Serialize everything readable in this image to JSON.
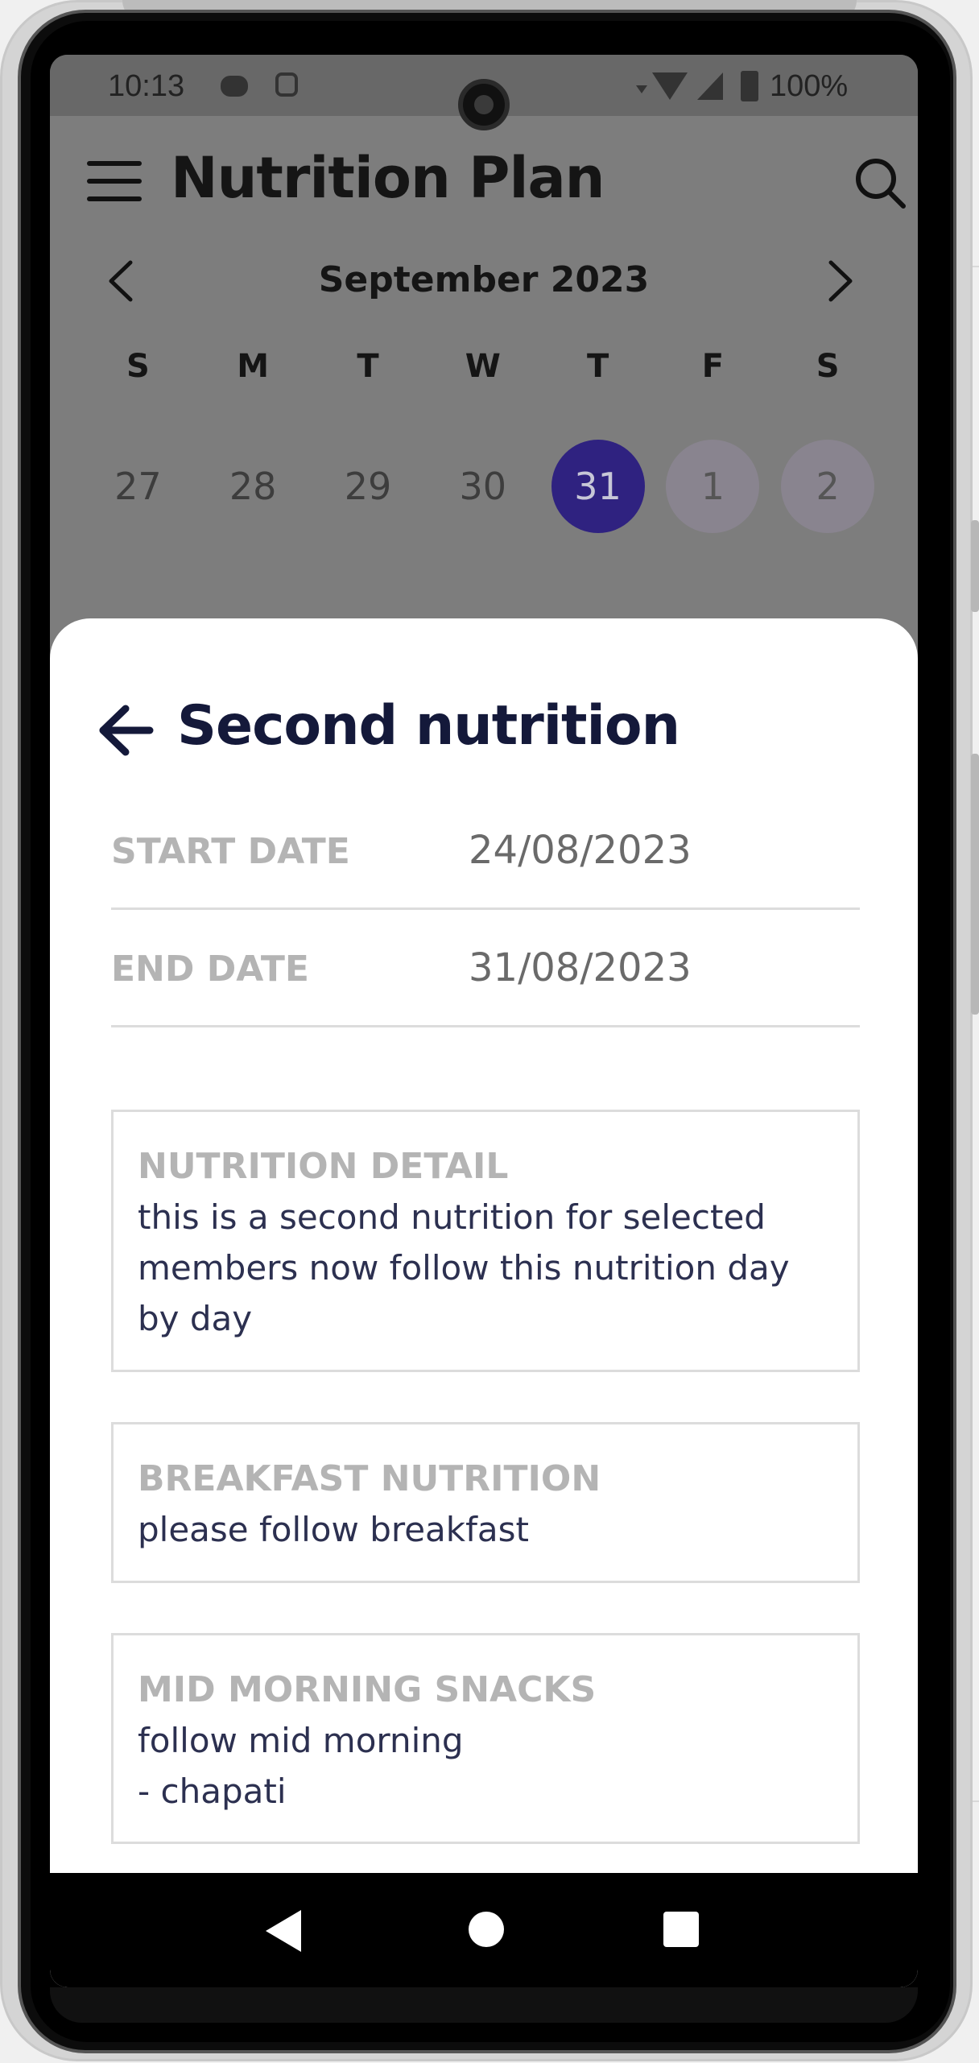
{
  "status_bar": {
    "time": "10:13",
    "battery": "100%"
  },
  "app_bar": {
    "title": "Nutrition Plan"
  },
  "calendar": {
    "month": "September 2023",
    "weekdays": [
      "S",
      "M",
      "T",
      "W",
      "T",
      "F",
      "S"
    ],
    "days": [
      "27",
      "28",
      "29",
      "30",
      "31",
      "1",
      "2"
    ],
    "selected_day": "31",
    "accent_color": "#2f2280"
  },
  "sheet": {
    "title": "Second nutrition",
    "start_date_label": "START DATE",
    "start_date_value": "24/08/2023",
    "end_date_label": "END DATE",
    "end_date_value": "31/08/2023",
    "cards": [
      {
        "label": "NUTRITION DETAIL",
        "text": "this is a second nutrition for selected members now follow this nutrition day by day"
      },
      {
        "label": "BREAKFAST NUTRITION",
        "text": "please follow breakfast"
      },
      {
        "label": "MID MORNING SNACKS",
        "text": "follow mid morning\n- chapati"
      }
    ]
  },
  "icons": {
    "menu": "hamburger-menu-icon",
    "search": "search-icon",
    "prev_month": "chevron-left-icon",
    "next_month": "chevron-right-icon",
    "back": "arrow-left-icon",
    "nav_back": "triangle-back-icon",
    "nav_home": "circle-home-icon",
    "nav_recents": "square-recents-icon"
  }
}
